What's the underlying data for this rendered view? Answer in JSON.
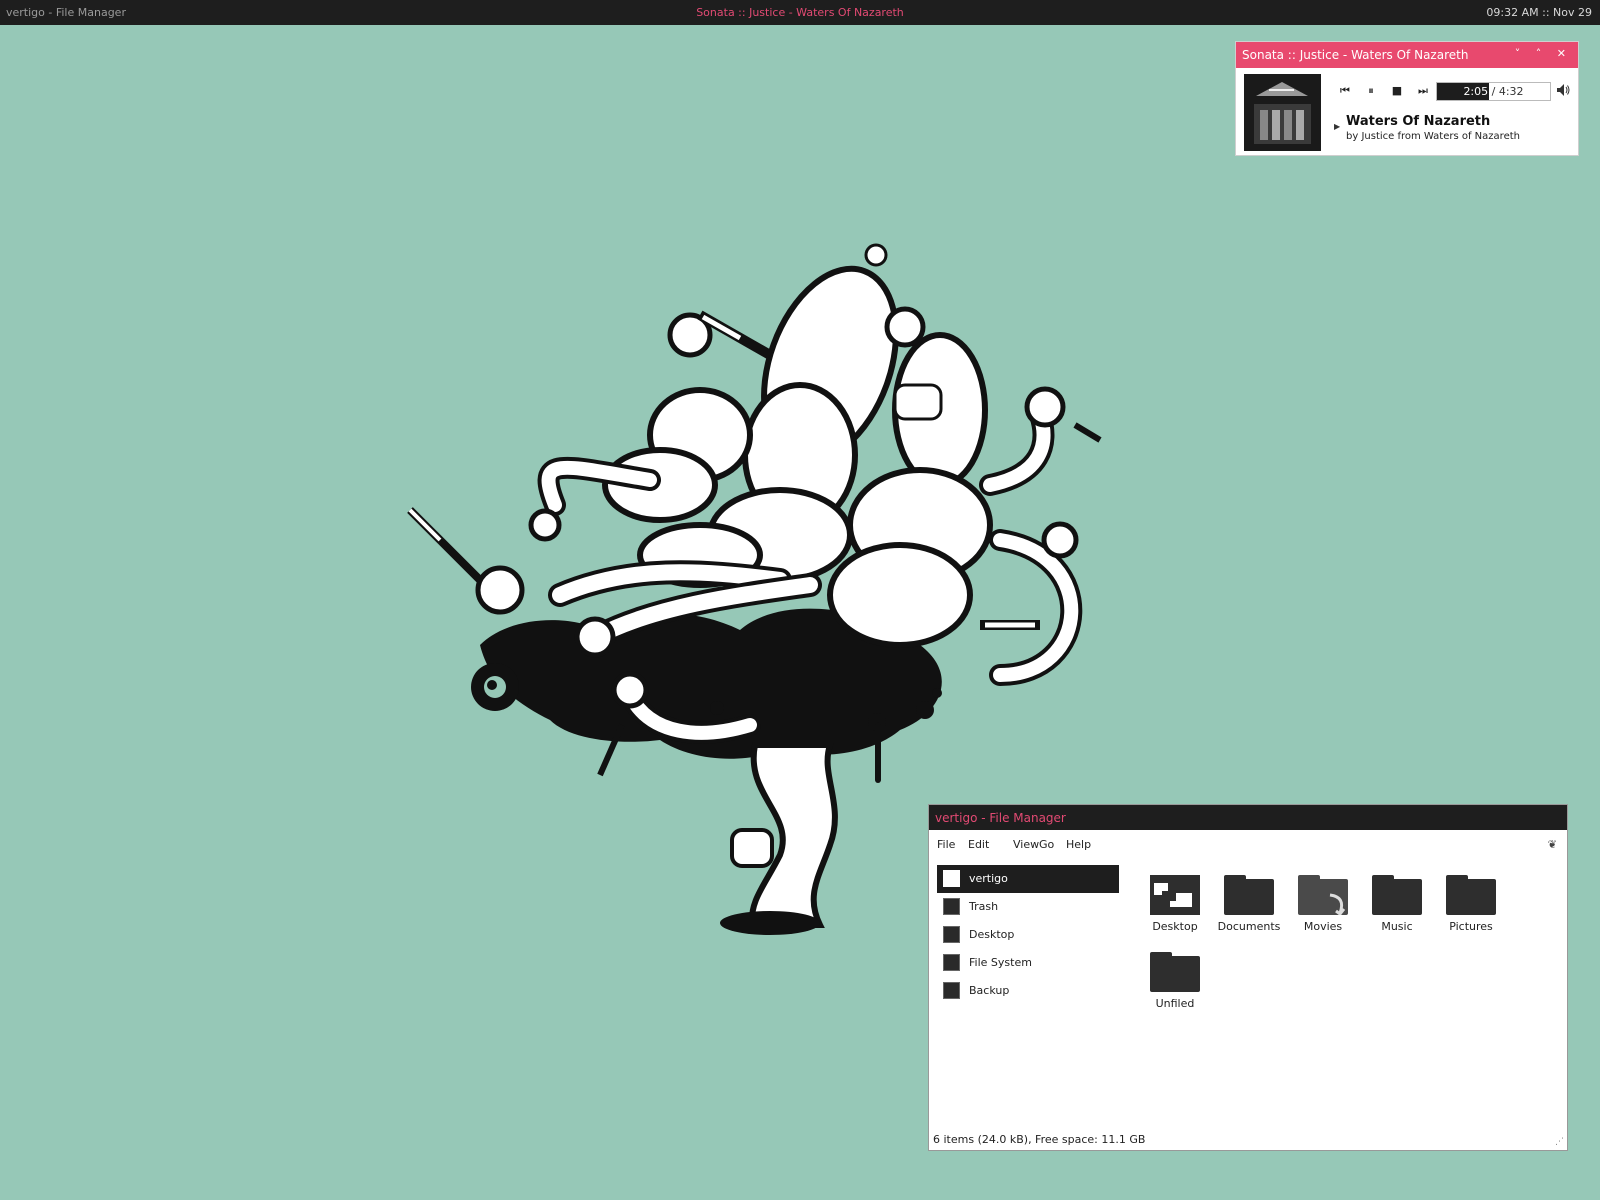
{
  "top_bar": {
    "left_title": "vertigo - File Manager",
    "center_title": "Sonata :: Justice - Waters Of Nazareth",
    "clock": "09:32 AM :: Nov 29"
  },
  "sonata": {
    "title": "Sonata :: Justice - Waters Of Nazareth",
    "window_controls": "˅ ˄ ✕",
    "elapsed": "2:05",
    "total": "/ 4:32",
    "progress_fraction": 0.46,
    "song_title": "Waters Of Nazareth",
    "byline": "by Justice from Waters of Nazareth",
    "icons": {
      "prev": "previous-track-icon",
      "pause": "pause-icon",
      "stop": "stop-icon",
      "next": "next-track-icon",
      "volume": "volume-icon",
      "expander": "expander-arrow-icon"
    },
    "accent_color": "#e8496e"
  },
  "file_manager": {
    "title": "vertigo - File Manager",
    "menus": [
      {
        "label": "File"
      },
      {
        "label": "Edit"
      },
      {
        "label": "View"
      },
      {
        "label": "Go"
      },
      {
        "label": "Help"
      }
    ],
    "sidebar": [
      {
        "label": "vertigo",
        "icon": "home-icon",
        "active": true
      },
      {
        "label": "Trash",
        "icon": "trash-icon",
        "active": false
      },
      {
        "label": "Desktop",
        "icon": "desktop-icon",
        "active": false
      },
      {
        "label": "File System",
        "icon": "drive-icon",
        "active": false
      },
      {
        "label": "Backup",
        "icon": "removable-drive-icon",
        "active": false
      }
    ],
    "files": [
      {
        "label": "Desktop",
        "icon": "desktop-folder-icon"
      },
      {
        "label": "Documents",
        "icon": "folder-icon"
      },
      {
        "label": "Movies",
        "icon": "symlink-folder-icon"
      },
      {
        "label": "Music",
        "icon": "folder-icon"
      },
      {
        "label": "Pictures",
        "icon": "folder-icon"
      },
      {
        "label": "Unfiled",
        "icon": "folder-icon"
      }
    ],
    "status": "6 items (24.0 kB), Free space: 11.1 GB"
  },
  "colors": {
    "desktop_background": "#96c8b7",
    "panel_background": "#1e1e1e",
    "accent_pink": "#e24a73"
  }
}
